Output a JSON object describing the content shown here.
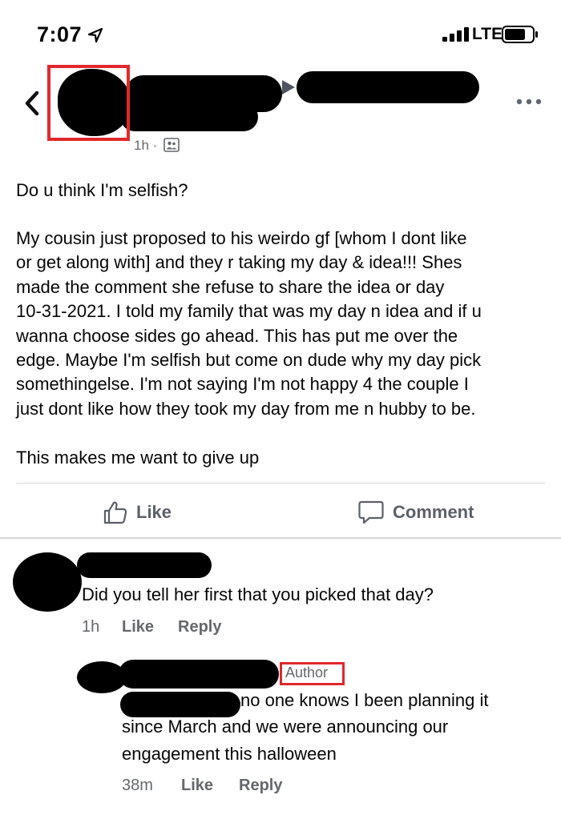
{
  "status_bar": {
    "time": "7:07",
    "network": "LTE"
  },
  "post": {
    "time": "1h ·",
    "question": "Do u think I'm selfish?",
    "body": "My cousin just proposed to his weirdo gf [whom I dont like\nor get along with] and they r taking my day & idea!!! Shes\nmade the comment she refuse to share the idea or day\n10-31-2021. I told my family that was my day n idea and if u\nwanna choose sides go ahead. This has put me over the\nedge. Maybe I'm selfish but come on dude why my day pick\nsomethingelse. I'm not saying I'm not happy 4 the couple I\njust dont like how they took my day from me n hubby to be.",
    "closing": "This makes me want to give up",
    "like_label": "Like",
    "comment_label": "Comment"
  },
  "comment": {
    "text": "Did you tell her first that you picked that day?",
    "time": "1h",
    "like": "Like",
    "reply": "Reply"
  },
  "reply": {
    "badge": "Author",
    "line1": "no one knows I been planning it",
    "line2": "since March and we were announcing our",
    "line3": "engagement this halloween",
    "time": "38m",
    "like": "Like",
    "reply": "Reply"
  },
  "colors": {
    "highlight_frame": "#e0282d",
    "secondary_text": "#65676b",
    "action_text": "#5c6069"
  }
}
